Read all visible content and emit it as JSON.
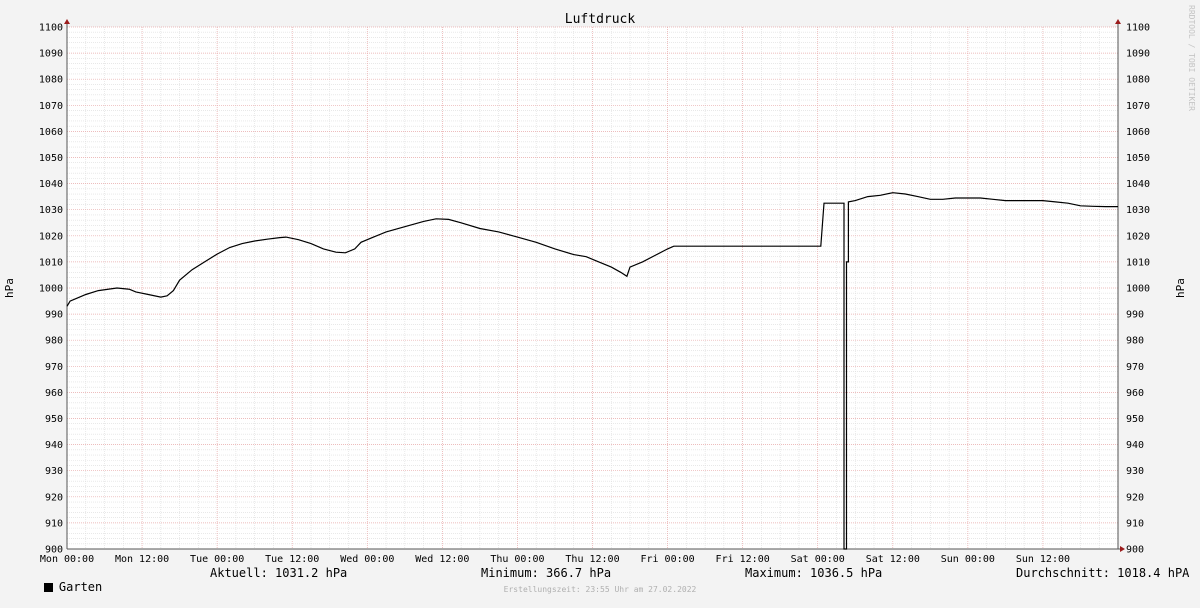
{
  "colors": {
    "background": "#f3f3f3",
    "plot_background": "#ffffff",
    "minor_grid": "#dcdcdc",
    "major_grid": "#e7a7a7",
    "axis_arrow": "#9b1c1c",
    "line": "#000000"
  },
  "watermark": "RRDTOOL / TOBI OETIKER",
  "credit": "Erstellungszeit: 23:55 Uhr am 27.02.2022",
  "legend": {
    "series_name": "Garten",
    "current": "Aktuell: 1031.2 hPa",
    "minimum": "Minimum: 366.7 hPa",
    "maximum": "Maximum: 1036.5 hPa",
    "average": "Durchschnitt: 1018.4 hPA"
  },
  "chart_data": {
    "type": "line",
    "title": "Luftdruck",
    "ylabel": "hPa",
    "ylabel_right": "hPa",
    "ylim": [
      900,
      1100
    ],
    "yticks": [
      900,
      910,
      920,
      930,
      940,
      950,
      960,
      970,
      980,
      990,
      1000,
      1010,
      1020,
      1030,
      1040,
      1050,
      1060,
      1070,
      1080,
      1090,
      1100
    ],
    "xlim": [
      0,
      168
    ],
    "x_unit": "hours since Mon 00:00",
    "xticks": [
      {
        "x": 0,
        "label": "Mon 00:00"
      },
      {
        "x": 12,
        "label": "Mon 12:00"
      },
      {
        "x": 24,
        "label": "Tue 00:00"
      },
      {
        "x": 36,
        "label": "Tue 12:00"
      },
      {
        "x": 48,
        "label": "Wed 00:00"
      },
      {
        "x": 60,
        "label": "Wed 12:00"
      },
      {
        "x": 72,
        "label": "Thu 00:00"
      },
      {
        "x": 84,
        "label": "Thu 12:00"
      },
      {
        "x": 96,
        "label": "Fri 00:00"
      },
      {
        "x": 108,
        "label": "Fri 12:00"
      },
      {
        "x": 120,
        "label": "Sat 00:00"
      },
      {
        "x": 132,
        "label": "Sat 12:00"
      },
      {
        "x": 144,
        "label": "Sun 00:00"
      },
      {
        "x": 156,
        "label": "Sun 12:00"
      }
    ],
    "grid": true,
    "legend_position": "bottom",
    "series": [
      {
        "name": "Garten",
        "points": [
          [
            0,
            993
          ],
          [
            0.5,
            995
          ],
          [
            1.5,
            996
          ],
          [
            3,
            997.5
          ],
          [
            5,
            999
          ],
          [
            8,
            1000
          ],
          [
            10,
            999.5
          ],
          [
            11,
            998.5
          ],
          [
            13,
            997.5
          ],
          [
            15,
            996.5
          ],
          [
            16,
            997
          ],
          [
            17,
            999
          ],
          [
            18,
            1003
          ],
          [
            20,
            1007
          ],
          [
            22,
            1010
          ],
          [
            24,
            1013
          ],
          [
            26,
            1015.5
          ],
          [
            28,
            1017
          ],
          [
            30,
            1018
          ],
          [
            32,
            1018.7
          ],
          [
            34,
            1019.3
          ],
          [
            35,
            1019.5
          ],
          [
            37,
            1018.5
          ],
          [
            39,
            1017
          ],
          [
            41,
            1015
          ],
          [
            43,
            1013.7
          ],
          [
            44.5,
            1013.5
          ],
          [
            46,
            1015
          ],
          [
            47,
            1017.5
          ],
          [
            49,
            1019.5
          ],
          [
            51,
            1021.5
          ],
          [
            54,
            1023.5
          ],
          [
            57,
            1025.5
          ],
          [
            59,
            1026.5
          ],
          [
            61,
            1026.3
          ],
          [
            63,
            1025
          ],
          [
            66,
            1022.8
          ],
          [
            69,
            1021.5
          ],
          [
            72,
            1019.5
          ],
          [
            75,
            1017.5
          ],
          [
            78,
            1015
          ],
          [
            81,
            1012.8
          ],
          [
            83,
            1012
          ],
          [
            85,
            1010
          ],
          [
            87,
            1008
          ],
          [
            88.5,
            1006
          ],
          [
            89.5,
            1004.5
          ],
          [
            90,
            1008
          ],
          [
            92,
            1010
          ],
          [
            94,
            1012.5
          ],
          [
            96,
            1015
          ],
          [
            97,
            1016
          ],
          [
            98,
            1016
          ],
          [
            100,
            1016
          ],
          [
            105,
            1016
          ],
          [
            110,
            1016
          ],
          [
            115,
            1016
          ],
          [
            118,
            1016
          ],
          [
            120.5,
            1016
          ],
          [
            121,
            1032.5
          ],
          [
            123.5,
            1032.5
          ],
          [
            124.2,
            1032.5
          ],
          [
            124.2,
            900
          ],
          [
            124.6,
            900
          ],
          [
            124.6,
            1010
          ],
          [
            124.9,
            1010
          ],
          [
            124.9,
            1033
          ],
          [
            126,
            1033.5
          ],
          [
            128,
            1035
          ],
          [
            130,
            1035.5
          ],
          [
            132,
            1036.5
          ],
          [
            134,
            1036
          ],
          [
            136,
            1035
          ],
          [
            138,
            1034
          ],
          [
            140,
            1034
          ],
          [
            142,
            1034.5
          ],
          [
            146,
            1034.5
          ],
          [
            148,
            1034
          ],
          [
            150,
            1033.5
          ],
          [
            154,
            1033.5
          ],
          [
            156,
            1033.5
          ],
          [
            158,
            1033
          ],
          [
            160,
            1032.5
          ],
          [
            162,
            1031.5
          ],
          [
            164,
            1031.3
          ],
          [
            166,
            1031.2
          ],
          [
            168,
            1031.2
          ]
        ]
      }
    ]
  }
}
